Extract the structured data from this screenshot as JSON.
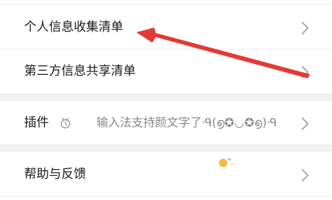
{
  "settings": {
    "items": [
      {
        "label": "个人信息收集清单"
      },
      {
        "label": "第三方信息共享清单"
      },
      {
        "label": "插件",
        "value": "输入法支持颜文字了ᑴ(൭✪◡✪൭)ᑴ"
      },
      {
        "label": "帮助与反馈"
      }
    ]
  },
  "icons": {
    "chevron": "chevron-right-icon",
    "plugin": "plugin-icon",
    "sparkle": "sparkle-icon",
    "annotation": "red-arrow-annotation"
  },
  "colors": {
    "text": "#1a1a1a",
    "muted": "#888888",
    "divider": "#f1f1f1",
    "arrow": "#e53935"
  }
}
